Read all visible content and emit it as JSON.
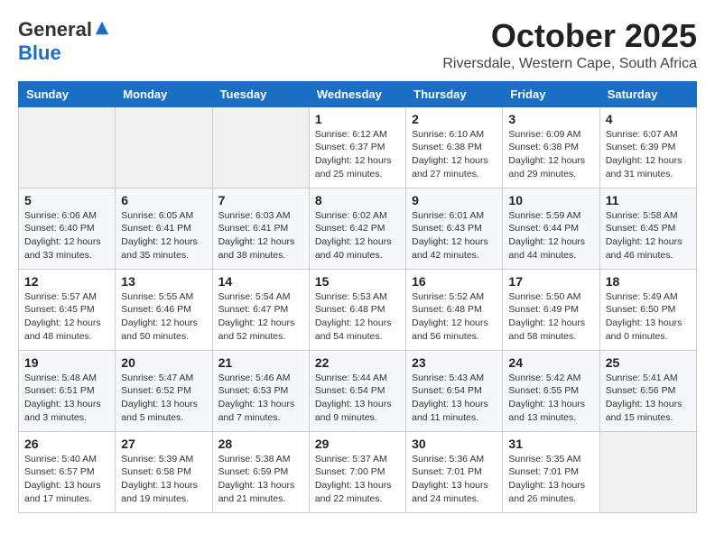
{
  "logo": {
    "general": "General",
    "blue": "Blue"
  },
  "header": {
    "title": "October 2025",
    "subtitle": "Riversdale, Western Cape, South Africa"
  },
  "days_of_week": [
    "Sunday",
    "Monday",
    "Tuesday",
    "Wednesday",
    "Thursday",
    "Friday",
    "Saturday"
  ],
  "weeks": [
    [
      {
        "day": "",
        "info": ""
      },
      {
        "day": "",
        "info": ""
      },
      {
        "day": "",
        "info": ""
      },
      {
        "day": "1",
        "info": "Sunrise: 6:12 AM\nSunset: 6:37 PM\nDaylight: 12 hours\nand 25 minutes."
      },
      {
        "day": "2",
        "info": "Sunrise: 6:10 AM\nSunset: 6:38 PM\nDaylight: 12 hours\nand 27 minutes."
      },
      {
        "day": "3",
        "info": "Sunrise: 6:09 AM\nSunset: 6:38 PM\nDaylight: 12 hours\nand 29 minutes."
      },
      {
        "day": "4",
        "info": "Sunrise: 6:07 AM\nSunset: 6:39 PM\nDaylight: 12 hours\nand 31 minutes."
      }
    ],
    [
      {
        "day": "5",
        "info": "Sunrise: 6:06 AM\nSunset: 6:40 PM\nDaylight: 12 hours\nand 33 minutes."
      },
      {
        "day": "6",
        "info": "Sunrise: 6:05 AM\nSunset: 6:41 PM\nDaylight: 12 hours\nand 35 minutes."
      },
      {
        "day": "7",
        "info": "Sunrise: 6:03 AM\nSunset: 6:41 PM\nDaylight: 12 hours\nand 38 minutes."
      },
      {
        "day": "8",
        "info": "Sunrise: 6:02 AM\nSunset: 6:42 PM\nDaylight: 12 hours\nand 40 minutes."
      },
      {
        "day": "9",
        "info": "Sunrise: 6:01 AM\nSunset: 6:43 PM\nDaylight: 12 hours\nand 42 minutes."
      },
      {
        "day": "10",
        "info": "Sunrise: 5:59 AM\nSunset: 6:44 PM\nDaylight: 12 hours\nand 44 minutes."
      },
      {
        "day": "11",
        "info": "Sunrise: 5:58 AM\nSunset: 6:45 PM\nDaylight: 12 hours\nand 46 minutes."
      }
    ],
    [
      {
        "day": "12",
        "info": "Sunrise: 5:57 AM\nSunset: 6:45 PM\nDaylight: 12 hours\nand 48 minutes."
      },
      {
        "day": "13",
        "info": "Sunrise: 5:55 AM\nSunset: 6:46 PM\nDaylight: 12 hours\nand 50 minutes."
      },
      {
        "day": "14",
        "info": "Sunrise: 5:54 AM\nSunset: 6:47 PM\nDaylight: 12 hours\nand 52 minutes."
      },
      {
        "day": "15",
        "info": "Sunrise: 5:53 AM\nSunset: 6:48 PM\nDaylight: 12 hours\nand 54 minutes."
      },
      {
        "day": "16",
        "info": "Sunrise: 5:52 AM\nSunset: 6:48 PM\nDaylight: 12 hours\nand 56 minutes."
      },
      {
        "day": "17",
        "info": "Sunrise: 5:50 AM\nSunset: 6:49 PM\nDaylight: 12 hours\nand 58 minutes."
      },
      {
        "day": "18",
        "info": "Sunrise: 5:49 AM\nSunset: 6:50 PM\nDaylight: 13 hours\nand 0 minutes."
      }
    ],
    [
      {
        "day": "19",
        "info": "Sunrise: 5:48 AM\nSunset: 6:51 PM\nDaylight: 13 hours\nand 3 minutes."
      },
      {
        "day": "20",
        "info": "Sunrise: 5:47 AM\nSunset: 6:52 PM\nDaylight: 13 hours\nand 5 minutes."
      },
      {
        "day": "21",
        "info": "Sunrise: 5:46 AM\nSunset: 6:53 PM\nDaylight: 13 hours\nand 7 minutes."
      },
      {
        "day": "22",
        "info": "Sunrise: 5:44 AM\nSunset: 6:54 PM\nDaylight: 13 hours\nand 9 minutes."
      },
      {
        "day": "23",
        "info": "Sunrise: 5:43 AM\nSunset: 6:54 PM\nDaylight: 13 hours\nand 11 minutes."
      },
      {
        "day": "24",
        "info": "Sunrise: 5:42 AM\nSunset: 6:55 PM\nDaylight: 13 hours\nand 13 minutes."
      },
      {
        "day": "25",
        "info": "Sunrise: 5:41 AM\nSunset: 6:56 PM\nDaylight: 13 hours\nand 15 minutes."
      }
    ],
    [
      {
        "day": "26",
        "info": "Sunrise: 5:40 AM\nSunset: 6:57 PM\nDaylight: 13 hours\nand 17 minutes."
      },
      {
        "day": "27",
        "info": "Sunrise: 5:39 AM\nSunset: 6:58 PM\nDaylight: 13 hours\nand 19 minutes."
      },
      {
        "day": "28",
        "info": "Sunrise: 5:38 AM\nSunset: 6:59 PM\nDaylight: 13 hours\nand 21 minutes."
      },
      {
        "day": "29",
        "info": "Sunrise: 5:37 AM\nSunset: 7:00 PM\nDaylight: 13 hours\nand 22 minutes."
      },
      {
        "day": "30",
        "info": "Sunrise: 5:36 AM\nSunset: 7:01 PM\nDaylight: 13 hours\nand 24 minutes."
      },
      {
        "day": "31",
        "info": "Sunrise: 5:35 AM\nSunset: 7:01 PM\nDaylight: 13 hours\nand 26 minutes."
      },
      {
        "day": "",
        "info": ""
      }
    ]
  ]
}
